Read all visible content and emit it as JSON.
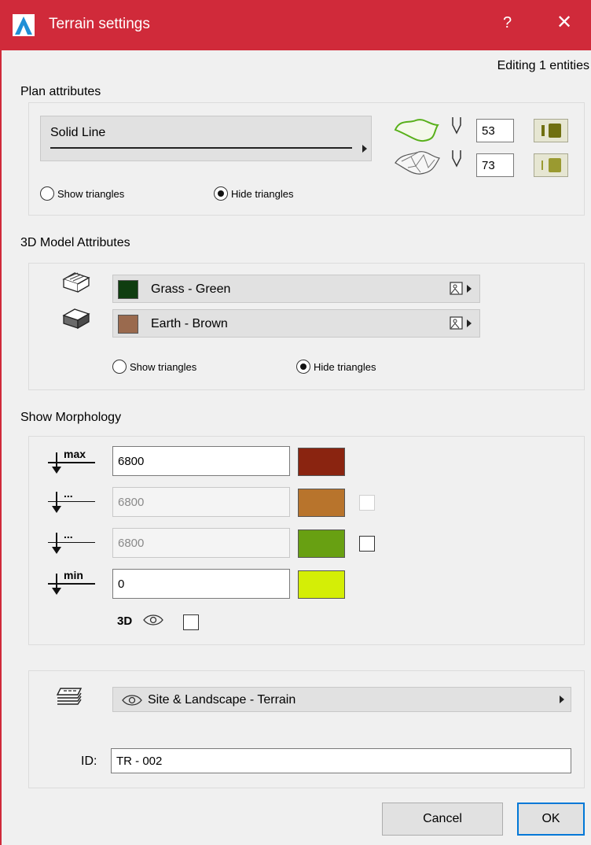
{
  "window": {
    "title": "Terrain settings",
    "help_label": "?",
    "close_label": "✕"
  },
  "editing_label": "Editing 1 entities",
  "plan": {
    "title": "Plan attributes",
    "line_type": "Solid Line",
    "contour_pen": "53",
    "fill_pen": "73",
    "show_triangles": "Show triangles",
    "hide_triangles": "Hide triangles"
  },
  "model3d": {
    "title": "3D Model Attributes",
    "surfaces": [
      {
        "label": "Grass - Green",
        "color": "#0f3d10"
      },
      {
        "label": "Earth - Brown",
        "color": "#9a6a4e"
      }
    ],
    "show_triangles": "Show triangles",
    "hide_triangles": "Hide triangles"
  },
  "morphology": {
    "title": "Show Morphology",
    "rows": [
      {
        "tag": "max",
        "value": "6800",
        "color": "#8a2410"
      },
      {
        "tag": "...",
        "value": "6800",
        "color": "#b8742c"
      },
      {
        "tag": "...",
        "value": "6800",
        "color": "#68a012"
      },
      {
        "tag": "min",
        "value": "0",
        "color": "#d4ee06"
      }
    ],
    "threed_label": "3D"
  },
  "layer": {
    "name": "Site & Landscape - Terrain",
    "id_label": "ID:",
    "id_value": "TR - 002"
  },
  "buttons": {
    "cancel": "Cancel",
    "ok": "OK"
  }
}
